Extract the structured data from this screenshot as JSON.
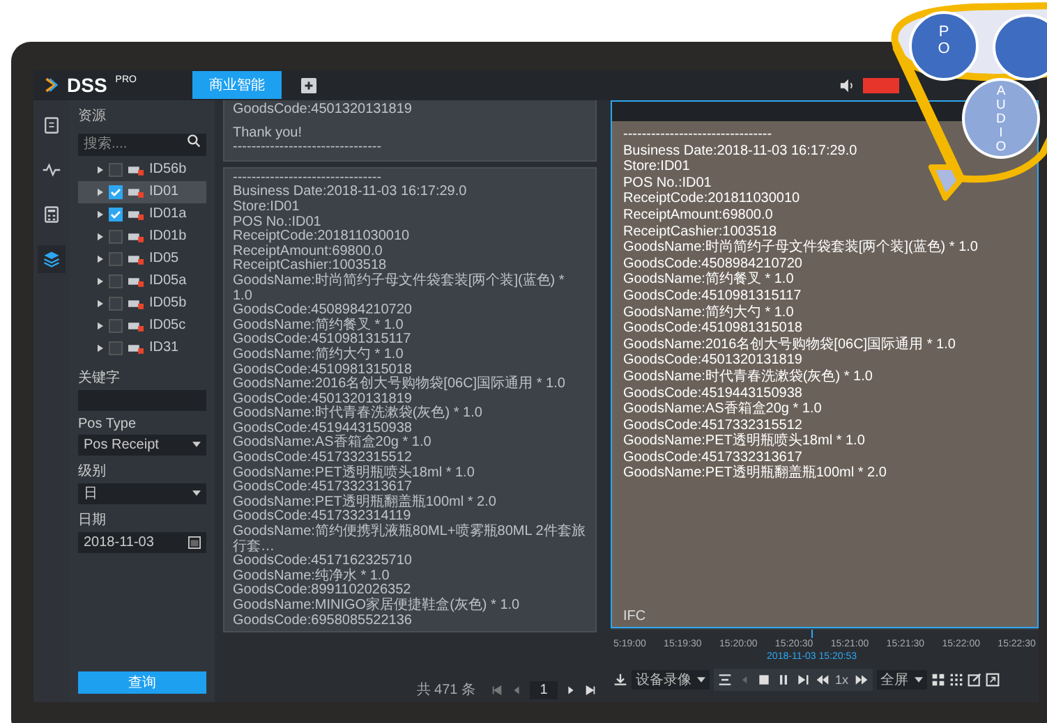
{
  "header": {
    "logo": "DSS",
    "logo_badge": "PRO",
    "tabs": [
      {
        "label": "商业智能",
        "selected": true
      }
    ],
    "recording": true
  },
  "rail": [
    {
      "kind": "clipboard",
      "selected": false
    },
    {
      "kind": "pulse",
      "selected": false
    },
    {
      "kind": "calculator",
      "selected": false
    },
    {
      "kind": "layers",
      "selected": true
    }
  ],
  "resources": {
    "title": "资源",
    "search_placeholder": "搜索....",
    "tree": [
      {
        "label": "ID56b",
        "checked": false,
        "selected": false
      },
      {
        "label": "ID01",
        "checked": true,
        "selected": true
      },
      {
        "label": "ID01a",
        "checked": true,
        "selected": false
      },
      {
        "label": "ID01b",
        "checked": false,
        "selected": false
      },
      {
        "label": "ID05",
        "checked": false,
        "selected": false
      },
      {
        "label": "ID05a",
        "checked": false,
        "selected": false
      },
      {
        "label": "ID05b",
        "checked": false,
        "selected": false
      },
      {
        "label": "ID05c",
        "checked": false,
        "selected": false
      },
      {
        "label": "ID31",
        "checked": false,
        "selected": false
      }
    ]
  },
  "filters": [
    {
      "kind": "text",
      "label": "关键字"
    },
    {
      "kind": "select",
      "label": "Pos Type",
      "value": "Pos Receipt"
    },
    {
      "kind": "select",
      "label": "级别",
      "value": "日"
    },
    {
      "kind": "date",
      "label": "日期",
      "value": "2018-11-03"
    }
  ],
  "query_button": "查询",
  "receipts": [
    {
      "lines": [
        "GoodsCode:4501320131819",
        "Thank you!",
        "--------------------------------"
      ]
    },
    {
      "lines": [
        "--------------------------------",
        "Business Date:2018-11-03 16:17:29.0",
        "Store:ID01",
        "POS No.:ID01",
        "ReceiptCode:201811030010",
        "ReceiptAmount:69800.0",
        "ReceiptCashier:1003518",
        "GoodsName:时尚简约子母文件袋套装[两个装](蓝色) * 1.0",
        "GoodsCode:4508984210720",
        "GoodsName:简约餐叉 * 1.0",
        "GoodsCode:4510981315117",
        "GoodsName:简约大勺 * 1.0",
        "GoodsCode:4510981315018",
        "GoodsName:2016名创大号购物袋[06C]国际通用 * 1.0",
        "GoodsCode:4501320131819",
        "GoodsName:时代青春洗漱袋(灰色) * 1.0",
        "GoodsCode:4519443150938",
        "GoodsName:AS香箱盒20g * 1.0",
        "GoodsCode:4517332315512",
        "GoodsName:PET透明瓶喷头18ml * 1.0",
        "GoodsCode:4517332313617",
        "GoodsName:PET透明瓶翻盖瓶100ml * 2.0",
        "GoodsCode:4517332314119",
        "GoodsName:简约便携乳液瓶80ML+喷雾瓶80ML 2件套旅行套…",
        "GoodsCode:4517162325710",
        "GoodsName:纯净水 * 1.0",
        "GoodsCode:8991102026352",
        "GoodsName:MINIGO家居便捷鞋盒(灰色) * 1.0",
        "GoodsCode:6958085522136"
      ]
    }
  ],
  "pager": {
    "total": "共 471 条",
    "page": "1"
  },
  "video": {
    "overlay_lines": [
      "--------------------------------",
      "Business Date:2018-11-03 16:17:29.0",
      "Store:ID01",
      "POS No.:ID01",
      "ReceiptCode:201811030010",
      "ReceiptAmount:69800.0",
      "ReceiptCashier:1003518",
      "GoodsName:时尚简约子母文件袋套装[两个装](蓝色) * 1.0",
      "GoodsCode:4508984210720",
      "GoodsName:简约餐叉 * 1.0",
      "GoodsCode:4510981315117",
      "GoodsName:简约大勺 * 1.0",
      "GoodsCode:4510981315018",
      "GoodsName:2016名创大号购物袋[06C]国际通用 * 1.0",
      "GoodsCode:4501320131819",
      "GoodsName:时代青春洗漱袋(灰色) * 1.0",
      "GoodsCode:4519443150938",
      "GoodsName:AS香箱盒20g * 1.0",
      "GoodsCode:4517332315512",
      "GoodsName:PET透明瓶喷头18ml * 1.0",
      "GoodsCode:4517332313617",
      "GoodsName:PET透明瓶翻盖瓶100ml * 2.0"
    ],
    "camera_label": "IFC",
    "timeline": {
      "ticks": [
        "5:19:00",
        "15:19:30",
        "15:20:00",
        "15:20:30",
        "15:21:00",
        "15:21:30",
        "15:22:00",
        "15:22:30"
      ],
      "cursor_time": "2018-11-03 15:20:53",
      "level": 0.47
    },
    "source": "设备录像",
    "speed": "1x",
    "layout": "全屏"
  },
  "callout": {
    "pos_label": "PO",
    "audio_label": "AUDIO"
  }
}
